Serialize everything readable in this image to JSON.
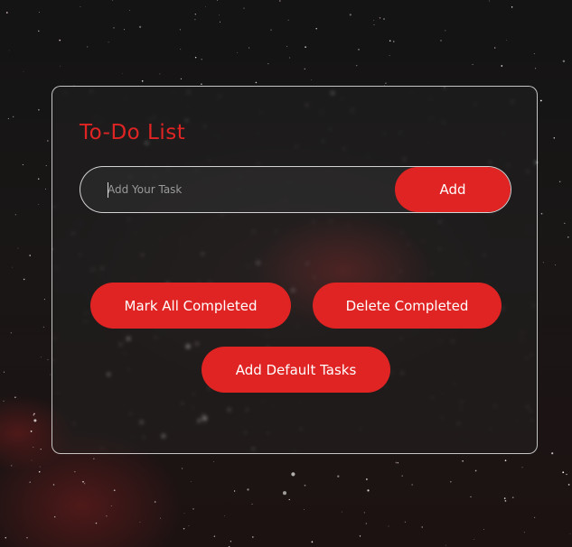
{
  "app": {
    "title": "To-Do List"
  },
  "task_input": {
    "placeholder": "Add Your Task",
    "value": ""
  },
  "buttons": {
    "add_label": "Add",
    "mark_all_label": "Mark All Completed",
    "delete_completed_label": "Delete Completed",
    "add_default_label": "Add Default Tasks"
  },
  "tasks": [],
  "colors": {
    "accent": "#e02424",
    "card_border": "#ffffff",
    "background": "#141414"
  }
}
